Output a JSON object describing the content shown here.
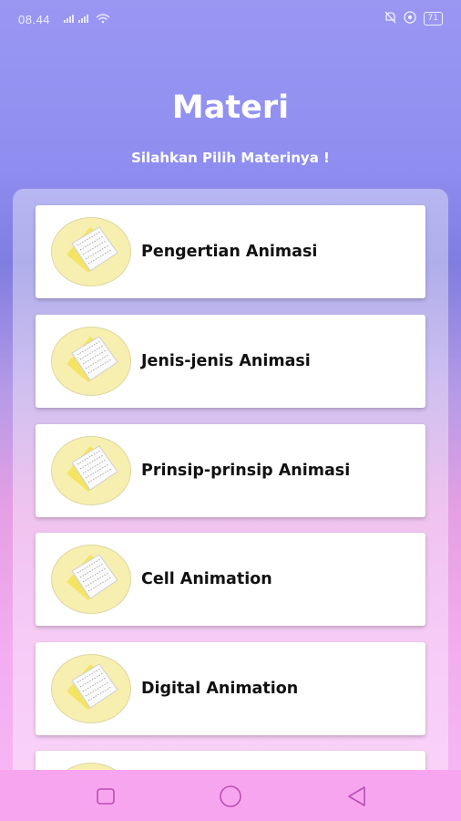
{
  "status_bar": {
    "time": "08.44",
    "signal": "‥…‥…",
    "battery": "71"
  },
  "header": {
    "title": "Materi",
    "subtitle": "Silahkan Pilih Materinya !"
  },
  "materials": [
    {
      "label": "Pengertian Animasi",
      "icon": "document-icon"
    },
    {
      "label": "Jenis-jenis Animasi",
      "icon": "document-icon"
    },
    {
      "label": "Prinsip-prinsip Animasi",
      "icon": "document-icon"
    },
    {
      "label": "Cell Animation",
      "icon": "document-icon"
    },
    {
      "label": "Digital Animation",
      "icon": "document-icon"
    },
    {
      "label": "",
      "icon": "document-icon"
    }
  ],
  "nav": {
    "recent": "square-icon",
    "home": "circle-icon",
    "back": "triangle-back-icon"
  },
  "colors": {
    "icon_circle": "#f7efb0",
    "nav_bar": "#f8a5f0",
    "card": "#ffffff"
  }
}
